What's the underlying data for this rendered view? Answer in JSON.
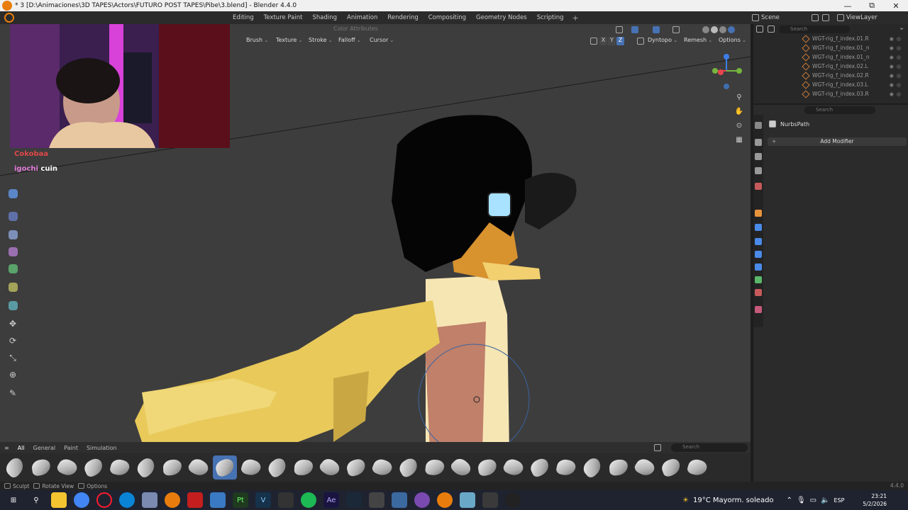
{
  "window": {
    "title": "* 3 [D:\\Animaciones\\3D TAPES\\Actors\\FUTURO POST TAPES\\Pibe\\3.blend] - Blender 4.4.0",
    "minimize": "—",
    "maximize": "⧉",
    "close": "✕"
  },
  "workspaces": {
    "tabs": [
      "Editing",
      "Texture Paint",
      "Shading",
      "Animation",
      "Rendering",
      "Compositing",
      "Geometry Nodes",
      "Scripting"
    ],
    "add": "+"
  },
  "scene": {
    "name": "Scene",
    "view_layer": "ViewLayer"
  },
  "viewport_header": {
    "color_attributes": "Color Attributes",
    "brush": "Brush",
    "texture": "Texture",
    "stroke": "Stroke",
    "falloff": "Falloff",
    "cursor": "Cursor",
    "axis_x": "X",
    "axis_y": "Y",
    "axis_z": "Z",
    "dyntopo": "Dyntopo",
    "remesh": "Remesh",
    "options": "Options"
  },
  "chat": {
    "line1": "Cokobaa",
    "line2_user": "igochi",
    "line2_text": "cuin"
  },
  "gizmo": {
    "x": "X",
    "y": "Y",
    "z": "Z",
    "x_color": "#e8454f",
    "y_color": "#77b63d",
    "z_color": "#3d7ee8"
  },
  "shelf": {
    "tabs": [
      "All",
      "General",
      "Paint",
      "Simulation"
    ],
    "active_tab": "All",
    "search_placeholder": "Search",
    "brush_count": 27,
    "active_brush_index": 8
  },
  "outliner": {
    "search_placeholder": "Search",
    "rows": [
      "WGT-rig_f_index.01.R",
      "WGT-rig_f_index.01_n",
      "WGT-rig_f_index.01_n",
      "WGT-rig_f_index.02.L",
      "WGT-rig_f_index.02.R",
      "WGT-rig_f_index.03.L",
      "WGT-rig_f_index.03.R"
    ]
  },
  "properties": {
    "search_placeholder": "Search",
    "object_name": "NurbsPath",
    "add_modifier": "Add Modifier"
  },
  "statusbar": {
    "sculpt": "Sculpt",
    "rotate_view": "Rotate View",
    "options": "Options",
    "version": "4.4.0"
  },
  "taskbar": {
    "weather": "19°C  Mayorm. soleado",
    "language": "ESP",
    "time": "23:21",
    "date": "5/2/2026"
  },
  "colors": {
    "accent": "#4772b3",
    "viewport_bg": "#3d3d3d",
    "panel_bg": "#2b2b2b"
  }
}
